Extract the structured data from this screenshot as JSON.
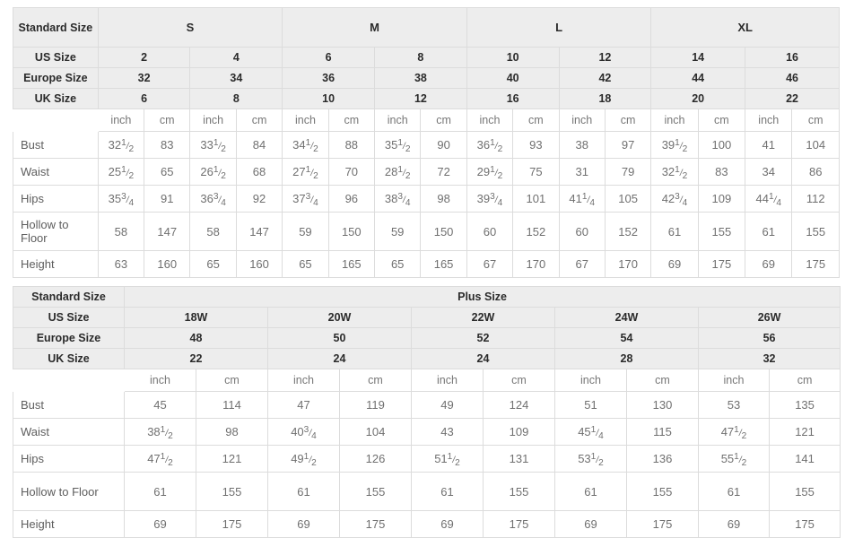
{
  "top_table": {
    "row_header_labels": {
      "standard_size": "Standard Size",
      "us_size": "US Size",
      "europe_size": "Europe Size",
      "uk_size": "UK Size"
    },
    "standard_sizes": [
      "S",
      "M",
      "L",
      "XL"
    ],
    "us_sizes": [
      "2",
      "4",
      "6",
      "8",
      "10",
      "12",
      "14",
      "16"
    ],
    "europe_sizes": [
      "32",
      "34",
      "36",
      "38",
      "40",
      "42",
      "44",
      "46"
    ],
    "uk_sizes": [
      "6",
      "8",
      "10",
      "12",
      "16",
      "18",
      "20",
      "22"
    ],
    "units": [
      "inch",
      "cm",
      "inch",
      "cm",
      "inch",
      "cm",
      "inch",
      "cm",
      "inch",
      "cm",
      "inch",
      "cm",
      "inch",
      "cm",
      "inch",
      "cm"
    ],
    "measurements": [
      {
        "label": "Bust",
        "values": [
          "32 1/2",
          "83",
          "33 1/2",
          "84",
          "34 1/2",
          "88",
          "35 1/2",
          "90",
          "36 1/2",
          "93",
          "38",
          "97",
          "39 1/2",
          "100",
          "41",
          "104"
        ]
      },
      {
        "label": "Waist",
        "values": [
          "25 1/2",
          "65",
          "26 1/2",
          "68",
          "27 1/2",
          "70",
          "28 1/2",
          "72",
          "29 1/2",
          "75",
          "31",
          "79",
          "32 1/2",
          "83",
          "34",
          "86"
        ]
      },
      {
        "label": "Hips",
        "values": [
          "35 3/4",
          "91",
          "36 3/4",
          "92",
          "37 3/4",
          "96",
          "38 3/4",
          "98",
          "39 3/4",
          "101",
          "41 1/4",
          "105",
          "42 3/4",
          "109",
          "44 1/4",
          "112"
        ]
      },
      {
        "label": "Hollow to Floor",
        "values": [
          "58",
          "147",
          "58",
          "147",
          "59",
          "150",
          "59",
          "150",
          "60",
          "152",
          "60",
          "152",
          "61",
          "155",
          "61",
          "155"
        ]
      },
      {
        "label": "Height",
        "values": [
          "63",
          "160",
          "65",
          "160",
          "65",
          "165",
          "65",
          "165",
          "67",
          "170",
          "67",
          "170",
          "69",
          "175",
          "69",
          "175"
        ]
      }
    ]
  },
  "bottom_table": {
    "row_header_labels": {
      "standard_size": "Standard Size",
      "us_size": "US Size",
      "europe_size": "Europe Size",
      "uk_size": "UK Size"
    },
    "standard_size_value": "Plus Size",
    "us_sizes": [
      "18W",
      "20W",
      "22W",
      "24W",
      "26W"
    ],
    "europe_sizes": [
      "48",
      "50",
      "52",
      "54",
      "56"
    ],
    "uk_sizes": [
      "22",
      "24",
      "24",
      "28",
      "32"
    ],
    "units": [
      "inch",
      "cm",
      "inch",
      "cm",
      "inch",
      "cm",
      "inch",
      "cm",
      "inch",
      "cm"
    ],
    "measurements": [
      {
        "label": "Bust",
        "values": [
          "45",
          "114",
          "47",
          "119",
          "49",
          "124",
          "51",
          "130",
          "53",
          "135"
        ]
      },
      {
        "label": "Waist",
        "values": [
          "38 1/2",
          "98",
          "40 3/4",
          "104",
          "43",
          "109",
          "45 1/4",
          "115",
          "47 1/2",
          "121"
        ]
      },
      {
        "label": "Hips",
        "values": [
          "47 1/2",
          "121",
          "49 1/2",
          "126",
          "51 1/2",
          "131",
          "53 1/2",
          "136",
          "55 1/2",
          "141"
        ]
      },
      {
        "label": "Hollow to Floor",
        "values": [
          "61",
          "155",
          "61",
          "155",
          "61",
          "155",
          "61",
          "155",
          "61",
          "155"
        ]
      },
      {
        "label": "Height",
        "values": [
          "69",
          "175",
          "69",
          "175",
          "69",
          "175",
          "69",
          "175",
          "69",
          "175"
        ]
      }
    ]
  },
  "colors": {
    "header_bg": "#ededed",
    "body_bg": "#ffffff",
    "border": "#dcdcdc",
    "header_text": "#2b2b2b",
    "body_text": "#707070"
  }
}
